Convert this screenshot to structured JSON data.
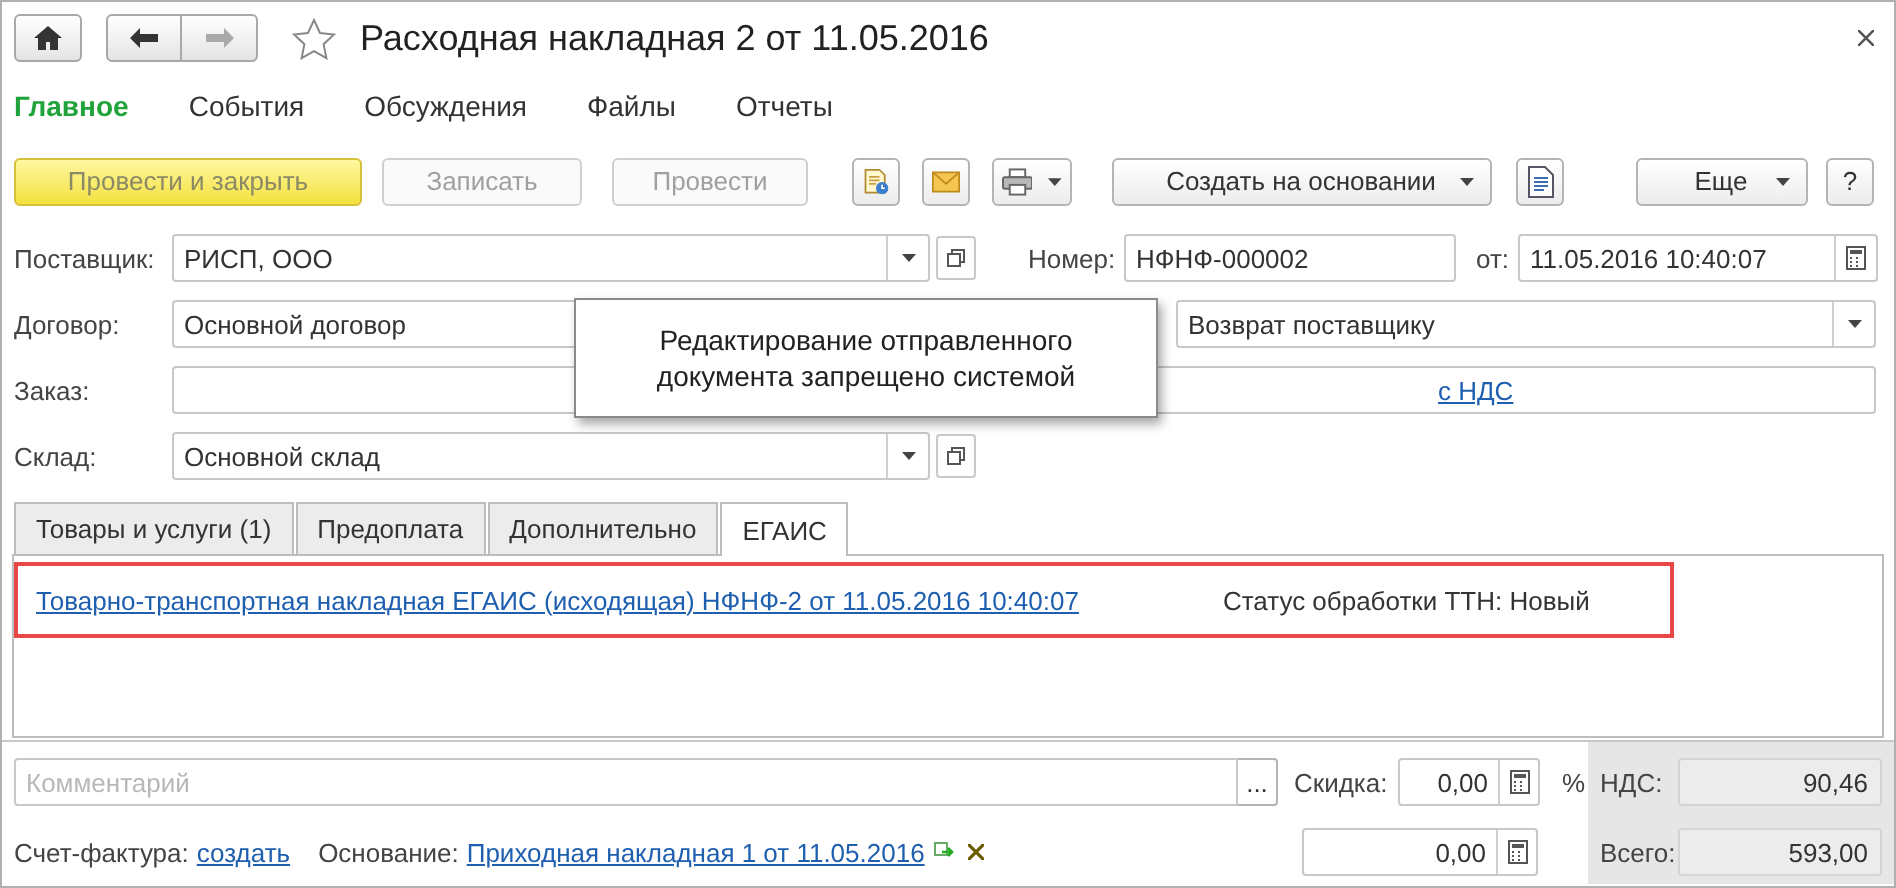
{
  "window": {
    "title": "Расходная накладная 2 от 11.05.2016"
  },
  "sections": [
    {
      "label": "Главное",
      "selected": true
    },
    {
      "label": "События",
      "selected": false
    },
    {
      "label": "Обсуждения",
      "selected": false
    },
    {
      "label": "Файлы",
      "selected": false
    },
    {
      "label": "Отчеты",
      "selected": false
    }
  ],
  "toolbar": [
    {
      "kind": "default",
      "label": "Провести и закрыть",
      "disabled": true
    },
    {
      "kind": "button",
      "label": "Записать",
      "disabled": true
    },
    {
      "kind": "button",
      "label": "Провести",
      "disabled": true
    },
    {
      "kind": "icon"
    },
    {
      "kind": "icon"
    },
    {
      "kind": "iconmenu"
    },
    {
      "kind": "menu",
      "label": "Создать на основании"
    },
    {
      "kind": "icon"
    },
    {
      "kind": "menu",
      "label": "Еще"
    },
    {
      "kind": "help",
      "label": "?"
    }
  ],
  "header": {
    "supplier": {
      "label": "Поставщик:",
      "value": "РИСП, ООО"
    },
    "number": {
      "label": "Номер:",
      "value": "НФНФ-000002"
    },
    "date": {
      "label": "от:",
      "value": "11.05.2016 10:40:07"
    },
    "contract": {
      "label": "Договор:",
      "value": "Основной договор"
    },
    "operation": {
      "value": "Возврат поставщику"
    },
    "order": {
      "label": "Заказ:"
    },
    "vat_link": "с НДС",
    "warehouse": {
      "label": "Склад:",
      "value": "Основной склад"
    }
  },
  "tooltip": {
    "text": "Редактирование отправленного документа запрещено системой"
  },
  "doc_tabs": [
    {
      "label": "Товары и услуги (1)",
      "selected": false
    },
    {
      "label": "Предоплата",
      "selected": false
    },
    {
      "label": "Дополнительно",
      "selected": false
    },
    {
      "label": "ЕГАИС",
      "selected": true
    }
  ],
  "egais": {
    "link": "Товарно-транспортная накладная ЕГАИС (исходящая) НФНФ-2 от 11.05.2016 10:40:07",
    "status": "Статус обработки ТТН: Новый"
  },
  "footer": {
    "comment": {
      "placeholder": "Комментарий",
      "button": "..."
    },
    "discount": {
      "label": "Скидка:",
      "value": "0,00",
      "unit": "%"
    },
    "invoice": {
      "label": "Счет-фактура:",
      "link": "создать"
    },
    "basis": {
      "label": "Основание:",
      "link": "Приходная накладная 1 от 11.05.2016"
    },
    "amount": {
      "value": "0,00"
    },
    "totals": [
      {
        "label": "НДС:",
        "value": "90,46"
      },
      {
        "label": "Всего:",
        "value": "593,00"
      }
    ]
  }
}
